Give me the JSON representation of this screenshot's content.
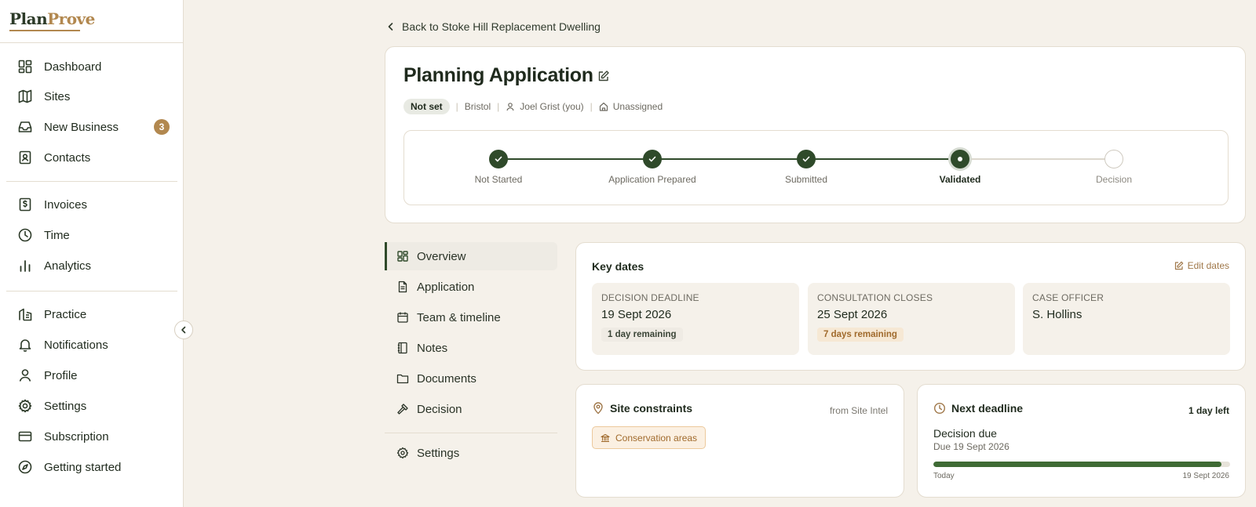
{
  "brand": {
    "part1": "Plan",
    "part2": "Prove"
  },
  "sidebar": {
    "groups": [
      [
        {
          "label": "Dashboard",
          "icon": "dashboard-icon"
        },
        {
          "label": "Sites",
          "icon": "map-icon"
        },
        {
          "label": "New Business",
          "icon": "inbox-icon",
          "badge": "3"
        },
        {
          "label": "Contacts",
          "icon": "contacts-icon"
        }
      ],
      [
        {
          "label": "Invoices",
          "icon": "invoice-icon"
        },
        {
          "label": "Time",
          "icon": "clock-icon"
        },
        {
          "label": "Analytics",
          "icon": "analytics-icon"
        }
      ],
      [
        {
          "label": "Practice",
          "icon": "building-icon"
        },
        {
          "label": "Notifications",
          "icon": "bell-icon"
        },
        {
          "label": "Profile",
          "icon": "user-icon"
        },
        {
          "label": "Settings",
          "icon": "gear-icon"
        },
        {
          "label": "Subscription",
          "icon": "card-icon"
        },
        {
          "label": "Getting started",
          "icon": "compass-icon"
        }
      ]
    ]
  },
  "back_link": "Back to Stoke Hill Replacement Dwelling",
  "header": {
    "title": "Planning Application",
    "status": "Not set",
    "location": "Bristol",
    "owner": "Joel Grist (you)",
    "assignee": "Unassigned"
  },
  "stepper": {
    "steps": [
      {
        "label": "Not Started",
        "state": "done"
      },
      {
        "label": "Application Prepared",
        "state": "done"
      },
      {
        "label": "Submitted",
        "state": "done"
      },
      {
        "label": "Validated",
        "state": "current"
      },
      {
        "label": "Decision",
        "state": "todo"
      }
    ]
  },
  "subnav": {
    "items": [
      {
        "label": "Overview",
        "icon": "overview-icon",
        "active": true
      },
      {
        "label": "Application",
        "icon": "document-icon"
      },
      {
        "label": "Team & timeline",
        "icon": "calendar-icon"
      },
      {
        "label": "Notes",
        "icon": "notebook-icon"
      },
      {
        "label": "Documents",
        "icon": "folder-icon"
      },
      {
        "label": "Decision",
        "icon": "gavel-icon"
      }
    ],
    "settings": {
      "label": "Settings",
      "icon": "gear-icon"
    }
  },
  "key_dates": {
    "title": "Key dates",
    "edit_label": "Edit dates",
    "tiles": [
      {
        "label": "DECISION DEADLINE",
        "value": "19 Sept 2026",
        "chip": "1 day remaining",
        "tone": "neutral"
      },
      {
        "label": "CONSULTATION CLOSES",
        "value": "25 Sept 2026",
        "chip": "7 days remaining",
        "tone": "warn"
      },
      {
        "label": "CASE OFFICER",
        "value": "S. Hollins"
      }
    ]
  },
  "site_constraints": {
    "title": "Site constraints",
    "source": "from Site Intel",
    "tags": [
      "Conservation areas"
    ]
  },
  "next_deadline": {
    "title": "Next deadline",
    "days_left": "1 day left",
    "item": "Decision due",
    "due": "Due 19 Sept 2026",
    "progress": 0.97,
    "start_label": "Today",
    "end_label": "19 Sept 2026"
  },
  "colors": {
    "accent": "#2f4a2a",
    "brand_gold": "#b2884f",
    "warning": "#a06a2c",
    "background": "#f5f1ea"
  }
}
